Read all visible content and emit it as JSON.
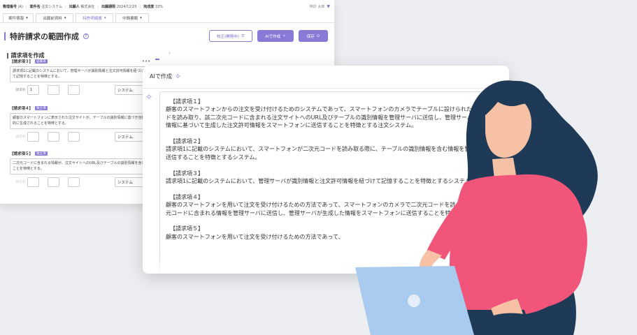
{
  "meta": {
    "items": [
      {
        "label": "整理番号",
        "value": "(A)"
      },
      {
        "label": "案件名",
        "value": "注文システム"
      },
      {
        "label": "出願人",
        "value": "株式会社"
      },
      {
        "label": "出願期限",
        "value": "2024/12/25"
      },
      {
        "label": "完成度",
        "value": "33%"
      }
    ],
    "user": "特許 太郎"
  },
  "tabs": [
    {
      "label": "案件情報"
    },
    {
      "label": "出願前資料"
    },
    {
      "label": "特許明細書"
    },
    {
      "label": "中間書類"
    }
  ],
  "page": {
    "title": "特許請求の範囲作成",
    "btn_edit": "校正(開発中)",
    "btn_ai": "AIで作成",
    "btn_save": "保存"
  },
  "section": {
    "title": "請求項を作成"
  },
  "claims_left": [
    {
      "head": "【請求項３】",
      "badge": "従属項",
      "text": "請求項1に記載のシステムにおいて、管理サーバが識別情報と注文許可情報を紐づけて記憶することを特徴とする。",
      "num": "1",
      "label": "請求項",
      "select": "システム"
    },
    {
      "head": "【請求項４】",
      "badge": "独立項",
      "text": "顧客のスマートフォンに表示された注文サイトが、テーブルの識別情報に基づき自動的に生成されることを特徴とする。",
      "num": "",
      "label": "請求項",
      "select": "システム"
    },
    {
      "head": "【請求項５】",
      "badge": "独立項",
      "text": "二次元コードに含まれる情報が、注文サイトへのURL及びテーブルの識別情報を含むことを特徴とする。",
      "num": "",
      "label": "請求項",
      "select": "システム"
    }
  ],
  "ai": {
    "title": "AIで作成",
    "claims": [
      {
        "head": "【請求項１】",
        "text": "顧客のスマートフォンからの注文を受け付けるためのシステムであって、スマートフォンのカメラでテーブルに設けられた二次元コードを読み取り、該二次元コードに含まれる注文サイトへのURL及びテーブルの識別情報を管理サーバに送信し、管理サーバが該識別情報に基づいて生成した注文許可情報をスマートフォンに送信することを特徴とする注文システム。"
      },
      {
        "head": "【請求項２】",
        "text": "請求項1に記載のシステムにおいて、スマートフォンが二次元コードを読み取る際に、テーブルの識別情報を含む情報を管理サーバに送信することを特徴とするシステム。"
      },
      {
        "head": "【請求項３】",
        "text": "請求項1に記載のシステムにおいて、管理サーバが識別情報と注文許可情報を紐づけて記憶することを特徴とするシステム。"
      },
      {
        "head": "【請求項４】",
        "text": "顧客のスマートフォンを用いて注文を受け付けるための方法であって、スマートフォンのカメラで二次元コードを読み取り、該二次元コードに含まれる情報を管理サーバに送信し、管理サーバが生成した情報をスマートフォンに送信することを特徴とする方法。"
      },
      {
        "head": "【請求項５】",
        "text": "顧客のスマートフォンを用いて注文を受け付けるための方法であって、"
      }
    ]
  },
  "colors": {
    "accent": "#8a7ad8",
    "skin": "#f6c1a4",
    "hair": "#1f3a56",
    "shirt": "#f2557a",
    "laptop": "#a9cbef"
  }
}
